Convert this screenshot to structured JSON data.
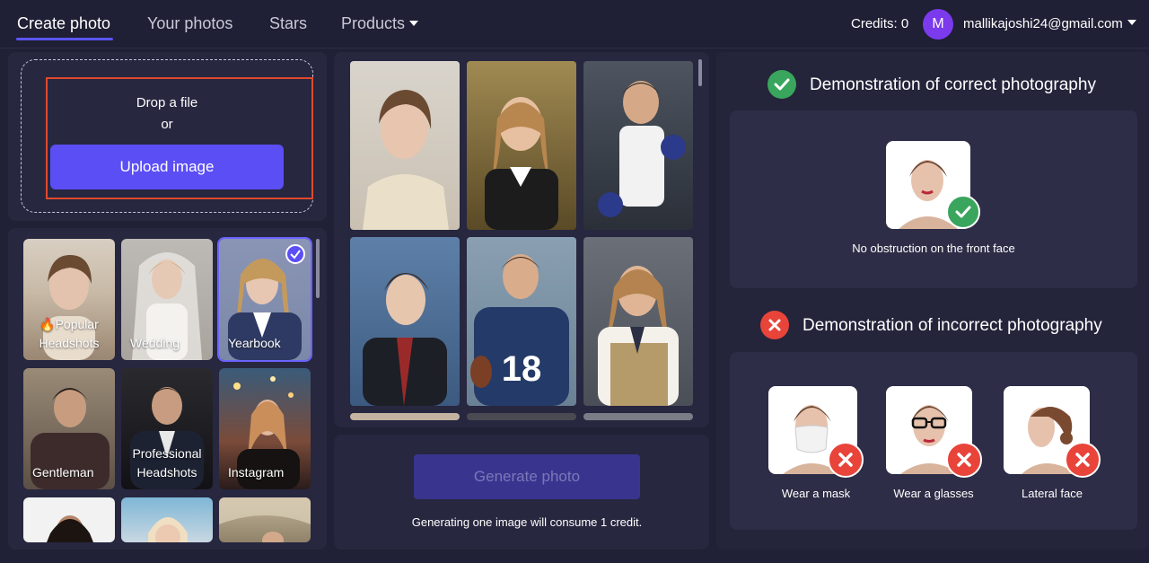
{
  "nav": {
    "tabs": [
      {
        "label": "Create photo"
      },
      {
        "label": "Your photos"
      },
      {
        "label": "Stars"
      },
      {
        "label": "Products"
      }
    ],
    "credits": "Credits: 0",
    "avatar_letter": "M",
    "email": "mallikajoshi24@gmail.com"
  },
  "upload": {
    "drop_text": "Drop a file",
    "or_text": "or",
    "button_label": "Upload image"
  },
  "styles": [
    {
      "label": "🔥Popular\nHeadshots",
      "selected": false
    },
    {
      "label": "Wedding",
      "selected": false
    },
    {
      "label": "Yearbook",
      "selected": true
    },
    {
      "label": "Gentleman",
      "selected": false
    },
    {
      "label": "Professional\nHeadshots",
      "selected": false
    },
    {
      "label": "Instagram",
      "selected": false
    }
  ],
  "generate": {
    "button_label": "Generate photo",
    "note": "Generating one image will consume 1 credit."
  },
  "correct": {
    "title": "Demonstration of correct photography",
    "caption": "No obstruction on the front face"
  },
  "incorrect": {
    "title": "Demonstration of incorrect photography",
    "items": [
      {
        "caption": "Wear a mask"
      },
      {
        "caption": "Wear a glasses"
      },
      {
        "caption": "Lateral face"
      }
    ]
  },
  "colors": {
    "accent": "#5b4ef5",
    "success": "#3aa55d",
    "error": "#e8443a",
    "background": "#202036",
    "panel": "#272740"
  }
}
